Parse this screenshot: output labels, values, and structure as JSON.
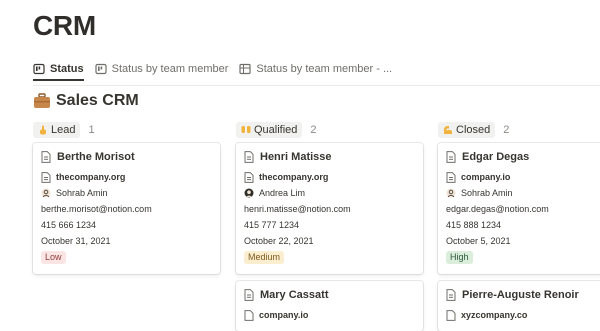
{
  "page": {
    "title": "CRM"
  },
  "tabs": [
    {
      "label": "Status",
      "icon": "board-icon",
      "active": true
    },
    {
      "label": "Status by team member",
      "icon": "board-icon",
      "active": false
    },
    {
      "label": "Status by team member - ...",
      "icon": "table-icon",
      "active": false
    }
  ],
  "database": {
    "title": "Sales CRM",
    "icon": "briefcase-emoji"
  },
  "columns": [
    {
      "status": "Lead",
      "emoji": "point-up-emoji",
      "count": "1",
      "cards": [
        {
          "name": "Berthe Morisot",
          "domain": "thecompany.org",
          "owner": "Sohrab Amin",
          "email": "berthe.morisot@notion.com",
          "phone": "415 666 1234",
          "date": "October 31, 2021",
          "priority": "Low",
          "priority_bg": "#fbe4e4",
          "priority_fg": "#93403c"
        }
      ]
    },
    {
      "status": "Qualified",
      "emoji": "raised-hands-emoji",
      "count": "2",
      "cards": [
        {
          "name": "Henri Matisse",
          "domain": "thecompany.org",
          "owner": "Andrea Lim",
          "email": "henri.matisse@notion.com",
          "phone": "415 777 1234",
          "date": "October 22, 2021",
          "priority": "Medium",
          "priority_bg": "#fbeecf",
          "priority_fg": "#7d5a1e"
        },
        {
          "name": "Mary Cassatt",
          "domain": "company.io"
        }
      ]
    },
    {
      "status": "Closed",
      "emoji": "flexed-biceps-emoji",
      "count": "2",
      "cards": [
        {
          "name": "Edgar Degas",
          "domain": "company.io",
          "owner": "Sohrab Amin",
          "email": "edgar.degas@notion.com",
          "phone": "415 888 1234",
          "date": "October 5, 2021",
          "priority": "High",
          "priority_bg": "#dbeddb",
          "priority_fg": "#2b593f"
        },
        {
          "name": "Pierre-Auguste Renoir",
          "domain": "xyzcompany.co"
        }
      ]
    }
  ]
}
